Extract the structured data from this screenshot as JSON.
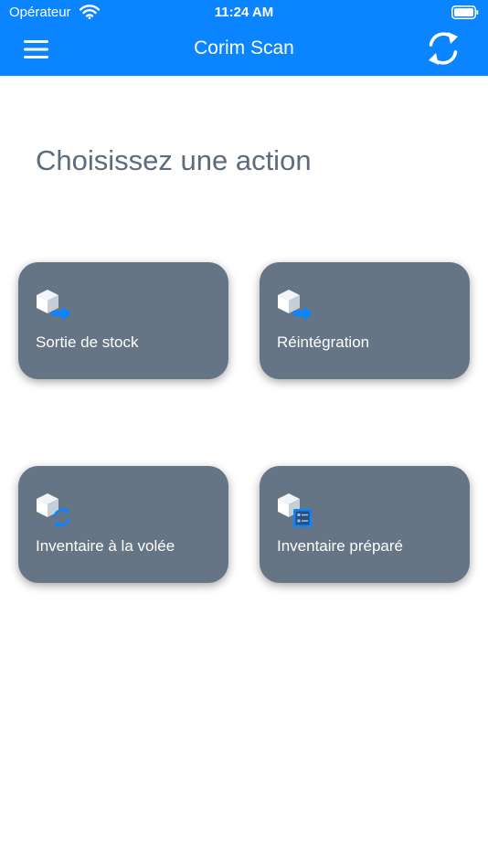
{
  "status_bar": {
    "carrier": "Opérateur",
    "time": "11:24 AM"
  },
  "nav_bar": {
    "title": "Corim Scan",
    "menu_icon": "hamburger-menu-icon",
    "sync_icon": "sync-icon"
  },
  "page": {
    "title": "Choisissez une action"
  },
  "actions": [
    {
      "label": "Sortie de stock",
      "icon": "box-arrow-right-icon"
    },
    {
      "label": "Réintégration",
      "icon": "box-arrow-in-icon"
    },
    {
      "label": "Inventaire à la volée",
      "icon": "box-refresh-icon"
    },
    {
      "label": "Inventaire préparé",
      "icon": "box-checklist-icon"
    }
  ],
  "colors": {
    "header": "#0a84ff",
    "tile": "#667585",
    "title_text": "#5d6b7c",
    "icon_accent": "#0a84ff"
  }
}
